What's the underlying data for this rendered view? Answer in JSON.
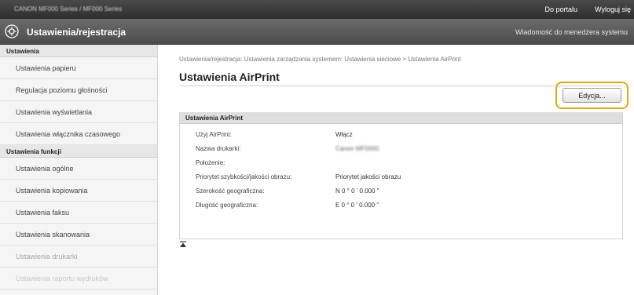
{
  "topbar": {
    "device_name": "CANON MF000 Series / MF000 Series",
    "portal_link": "Do portalu",
    "logout_link": "Wyloguj się"
  },
  "titlebar": {
    "title": "Ustawienia/rejestracja",
    "message_link": "Wiadomość do menedżera systemu"
  },
  "sidebar": {
    "section1": "Ustawienia",
    "items1": [
      "Ustawienia papieru",
      "Regulacja poziomu głośności",
      "Ustawienia wyświetlania",
      "Ustawienia włącznika czasowego"
    ],
    "section2": "Ustawienia funkcji",
    "items2": [
      "Ustawienia ogólne",
      "Ustawienia kopiowania",
      "Ustawienia faksu",
      "Ustawienia skanowania",
      "Ustawienia drukarki",
      "Ustawienia raportu wydruków"
    ]
  },
  "main": {
    "breadcrumb": "Ustawienia/rejestracja: Ustawienia zarządzania systemem: Ustawienia sieciowe > Ustawienia AirPrint",
    "page_title": "Ustawienia AirPrint",
    "edit_button": "Edycja..."
  },
  "panel": {
    "title": "Ustawienia AirPrint",
    "rows": [
      {
        "label": "Użyj AirPrint:",
        "value": "Włącz"
      },
      {
        "label": "Nazwa drukarki:",
        "value": "Canon MF0000"
      },
      {
        "label": "Położenie:",
        "value": ""
      },
      {
        "label": "Priorytet szybkości/jakości obrazu:",
        "value": "Priorytet jakości obrazu"
      },
      {
        "label": "Szerokość geograficzna:",
        "value": "N 0 ° 0 ' 0.000 \""
      },
      {
        "label": "Długość geograficzna:",
        "value": "E 0 ° 0 ' 0.000 \""
      }
    ]
  },
  "colors": {
    "highlight": "#f0a500",
    "topbar": "#3a3a3a",
    "titlebar": "#5a5a5a"
  },
  "icons": {
    "title_icon": "gear-settings-icon",
    "to_top_icon": "to-top-arrow-icon"
  }
}
